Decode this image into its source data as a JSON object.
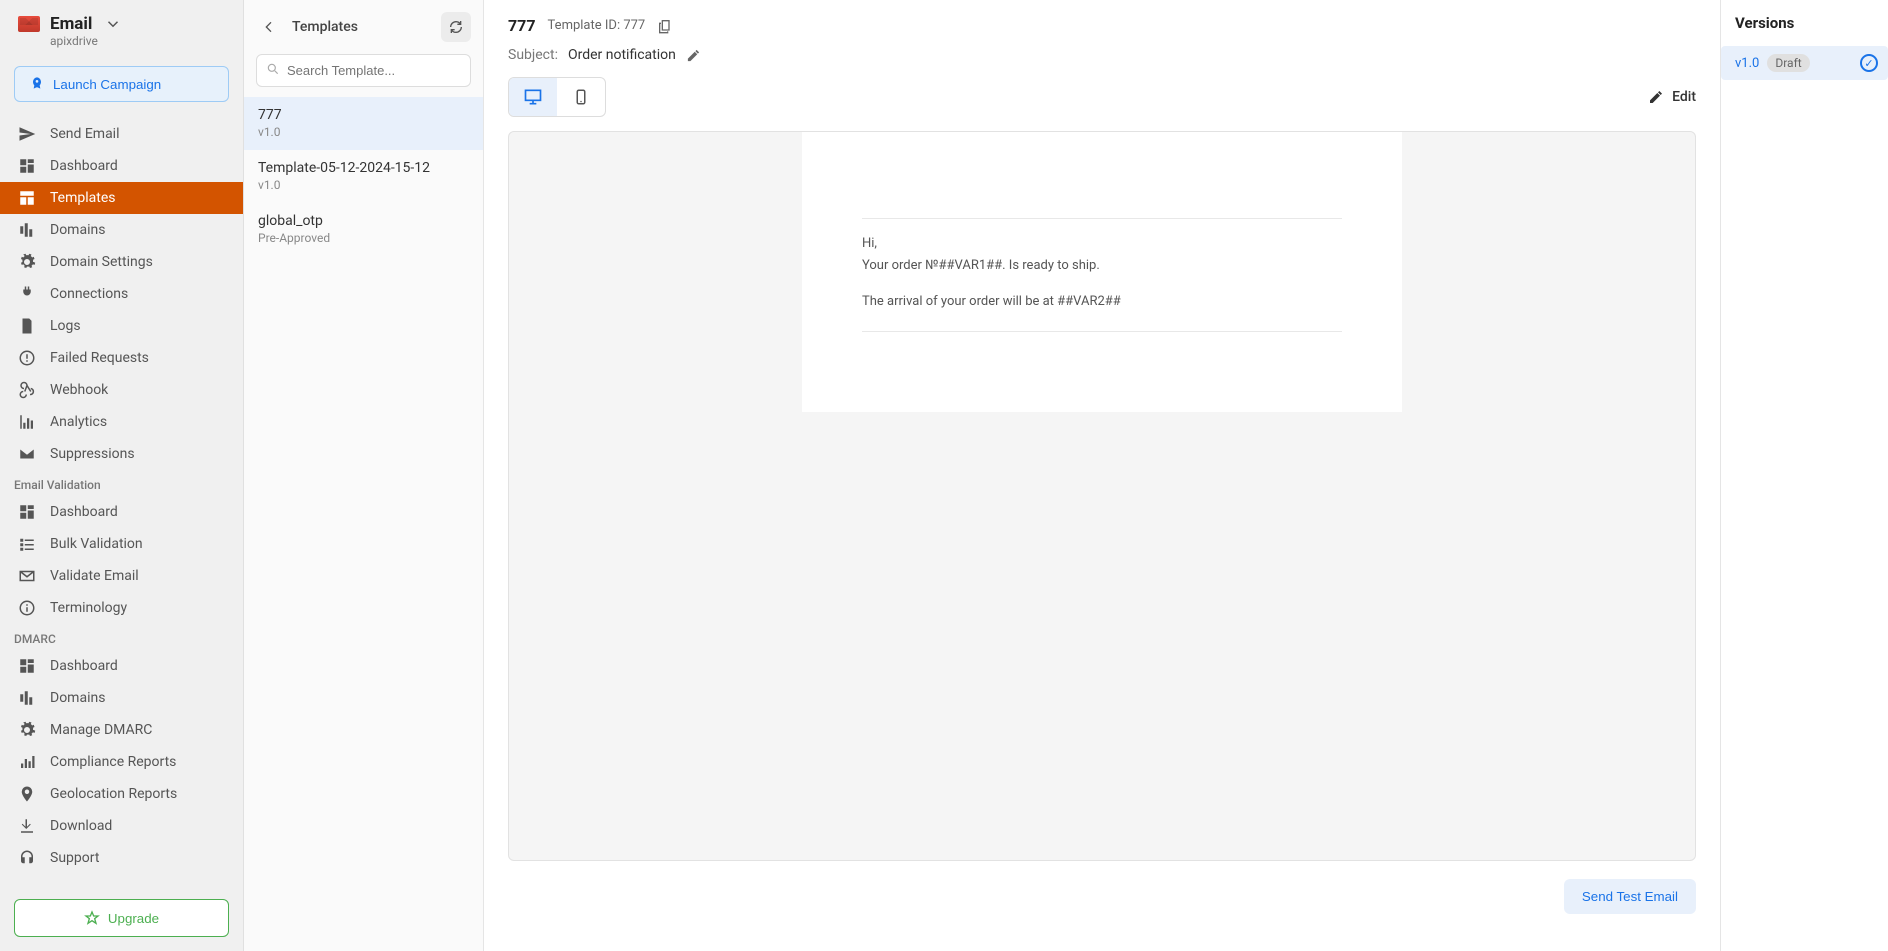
{
  "brand": {
    "title": "Email",
    "subtitle": "apixdrive"
  },
  "launch_campaign": "Launch Campaign",
  "nav": {
    "items": [
      {
        "label": "Send Email"
      },
      {
        "label": "Dashboard"
      },
      {
        "label": "Templates"
      },
      {
        "label": "Domains"
      },
      {
        "label": "Domain Settings"
      },
      {
        "label": "Connections"
      },
      {
        "label": "Logs"
      },
      {
        "label": "Failed Requests"
      },
      {
        "label": "Webhook"
      },
      {
        "label": "Analytics"
      },
      {
        "label": "Suppressions"
      }
    ],
    "validation_header": "Email Validation",
    "validation_items": [
      {
        "label": "Dashboard"
      },
      {
        "label": "Bulk Validation"
      },
      {
        "label": "Validate Email"
      },
      {
        "label": "Terminology"
      }
    ],
    "dmarc_header": "DMARC",
    "dmarc_items": [
      {
        "label": "Dashboard"
      },
      {
        "label": "Domains"
      },
      {
        "label": "Manage DMARC"
      },
      {
        "label": "Compliance Reports"
      },
      {
        "label": "Geolocation Reports"
      },
      {
        "label": "Download"
      },
      {
        "label": "Support"
      }
    ]
  },
  "upgrade": "Upgrade",
  "templates_col": {
    "title": "Templates",
    "search_placeholder": "Search Template...",
    "items": [
      {
        "title": "777",
        "sub": "v1.0"
      },
      {
        "title": "Template-05-12-2024-15-12",
        "sub": "v1.0"
      },
      {
        "title": "global_otp",
        "sub": "Pre-Approved"
      }
    ]
  },
  "main": {
    "template_name": "777",
    "template_id_label": "Template ID: 777",
    "subject_label": "Subject:",
    "subject_value": "Order notification",
    "edit_label": "Edit",
    "email_line1": "Hi,",
    "email_line2": "Your order №##VAR1##. Is ready to ship.",
    "email_line3": "The arrival of your order will be at ##VAR2##",
    "send_test": "Send Test Email"
  },
  "versions": {
    "title": "Versions",
    "items": [
      {
        "version": "v1.0",
        "badge": "Draft"
      }
    ]
  }
}
